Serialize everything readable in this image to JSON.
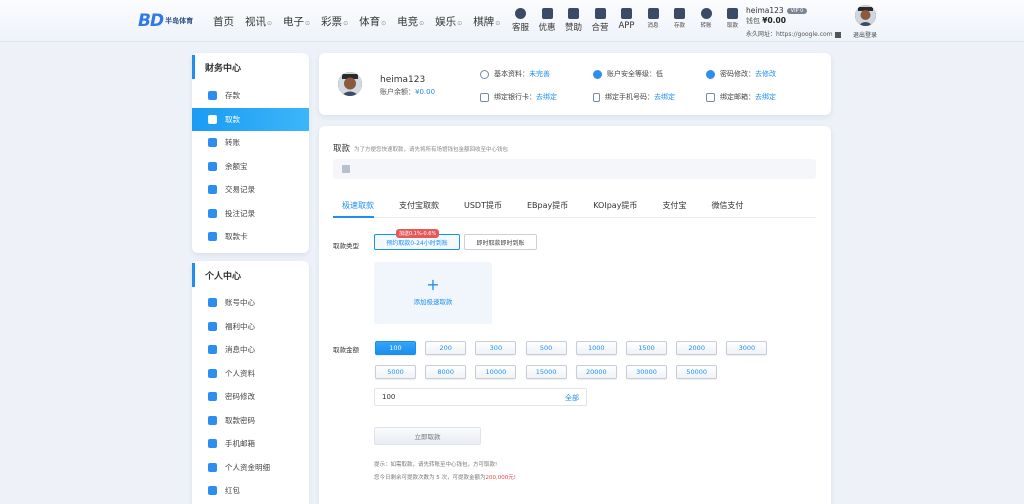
{
  "brand": {
    "mark": "BD",
    "name": "半岛体育"
  },
  "nav": [
    {
      "label": "首页",
      "caret": false
    },
    {
      "label": "视讯",
      "caret": true
    },
    {
      "label": "电子",
      "caret": true
    },
    {
      "label": "彩票",
      "caret": true
    },
    {
      "label": "体育",
      "caret": true
    },
    {
      "label": "电竞",
      "caret": true
    },
    {
      "label": "娱乐",
      "caret": true
    },
    {
      "label": "棋牌",
      "caret": true
    }
  ],
  "caret_symbol": "⊙",
  "quick": [
    {
      "label": "客服",
      "icon": "headset-icon"
    },
    {
      "label": "优惠",
      "icon": "gift-icon"
    },
    {
      "label": "赞助",
      "icon": "star-badge-icon"
    },
    {
      "label": "合营",
      "icon": "handshake-icon"
    },
    {
      "label": "APP",
      "icon": "phone-icon"
    }
  ],
  "quick_small": [
    {
      "label": "消息",
      "icon": "message-icon"
    },
    {
      "label": "存款",
      "icon": "deposit-icon"
    },
    {
      "label": "转账",
      "icon": "transfer-icon"
    },
    {
      "label": "取款",
      "icon": "withdraw-icon"
    }
  ],
  "user_top": {
    "name": "heima123",
    "vip": "VIP 0",
    "balance_label": "钱包",
    "balance": "¥0.00",
    "url": "永久网址：https://google.com",
    "logout": "退出登录"
  },
  "sidebar": {
    "finance_title": "财务中心",
    "finance_items": [
      {
        "label": "存款",
        "active": false
      },
      {
        "label": "取款",
        "active": true
      },
      {
        "label": "转账",
        "active": false
      },
      {
        "label": "余额宝",
        "active": false
      },
      {
        "label": "交易记录",
        "active": false
      },
      {
        "label": "投注记录",
        "active": false
      },
      {
        "label": "取款卡",
        "active": false
      }
    ],
    "personal_title": "个人中心",
    "personal_items": [
      {
        "label": "账号中心"
      },
      {
        "label": "福利中心"
      },
      {
        "label": "消息中心"
      },
      {
        "label": "个人资料"
      },
      {
        "label": "密码修改"
      },
      {
        "label": "取款密码"
      },
      {
        "label": "手机邮箱"
      },
      {
        "label": "个人资金明细"
      },
      {
        "label": "红包"
      }
    ]
  },
  "profile": {
    "name": "heima123",
    "balance_label": "账户余额：",
    "balance": "¥0.00",
    "info_label": "基本资料：",
    "info_value": "未完善",
    "security_label": "账户安全等级：",
    "security_value": "低",
    "password_label": "密码修改：",
    "password_value": "去修改",
    "card_label": "绑定银行卡：",
    "card_value": "去绑定",
    "phone_label": "绑定手机号码：",
    "phone_value": "去绑定",
    "email_label": "绑定邮箱：",
    "email_value": "去绑定"
  },
  "withdraw": {
    "title": "取款",
    "subtitle": "为了方便您快速取款，请先将所有场馆钱包金额回收至中心钱包",
    "tabs": [
      "极速取款",
      "支付宝取款",
      "USDT提币",
      "EBpay提币",
      "KOIpay提币",
      "支付宝",
      "微信支付"
    ],
    "type_label": "取款类型",
    "type_options": [
      "预约取款0-24小时到账",
      "即时取款即时到账"
    ],
    "bonus_badge": "加送0.1%-0.6%",
    "add_label": "添加极速取款",
    "amount_label": "取款金额",
    "amounts": [
      "100",
      "200",
      "300",
      "500",
      "1000",
      "1500",
      "2000",
      "3000",
      "5000",
      "8000",
      "10000",
      "15000",
      "20000",
      "30000",
      "50000"
    ],
    "input_value": "100",
    "all_label": "全部",
    "submit": "立即取款",
    "tip1": "提示：如需取款，请先转账至中心钱包，方可取款!",
    "tip2_prefix": "您今日剩余可提款次数为 5 次，可提款金额为",
    "tip2_amount": "200,000元",
    "tip2_suffix": "!"
  }
}
